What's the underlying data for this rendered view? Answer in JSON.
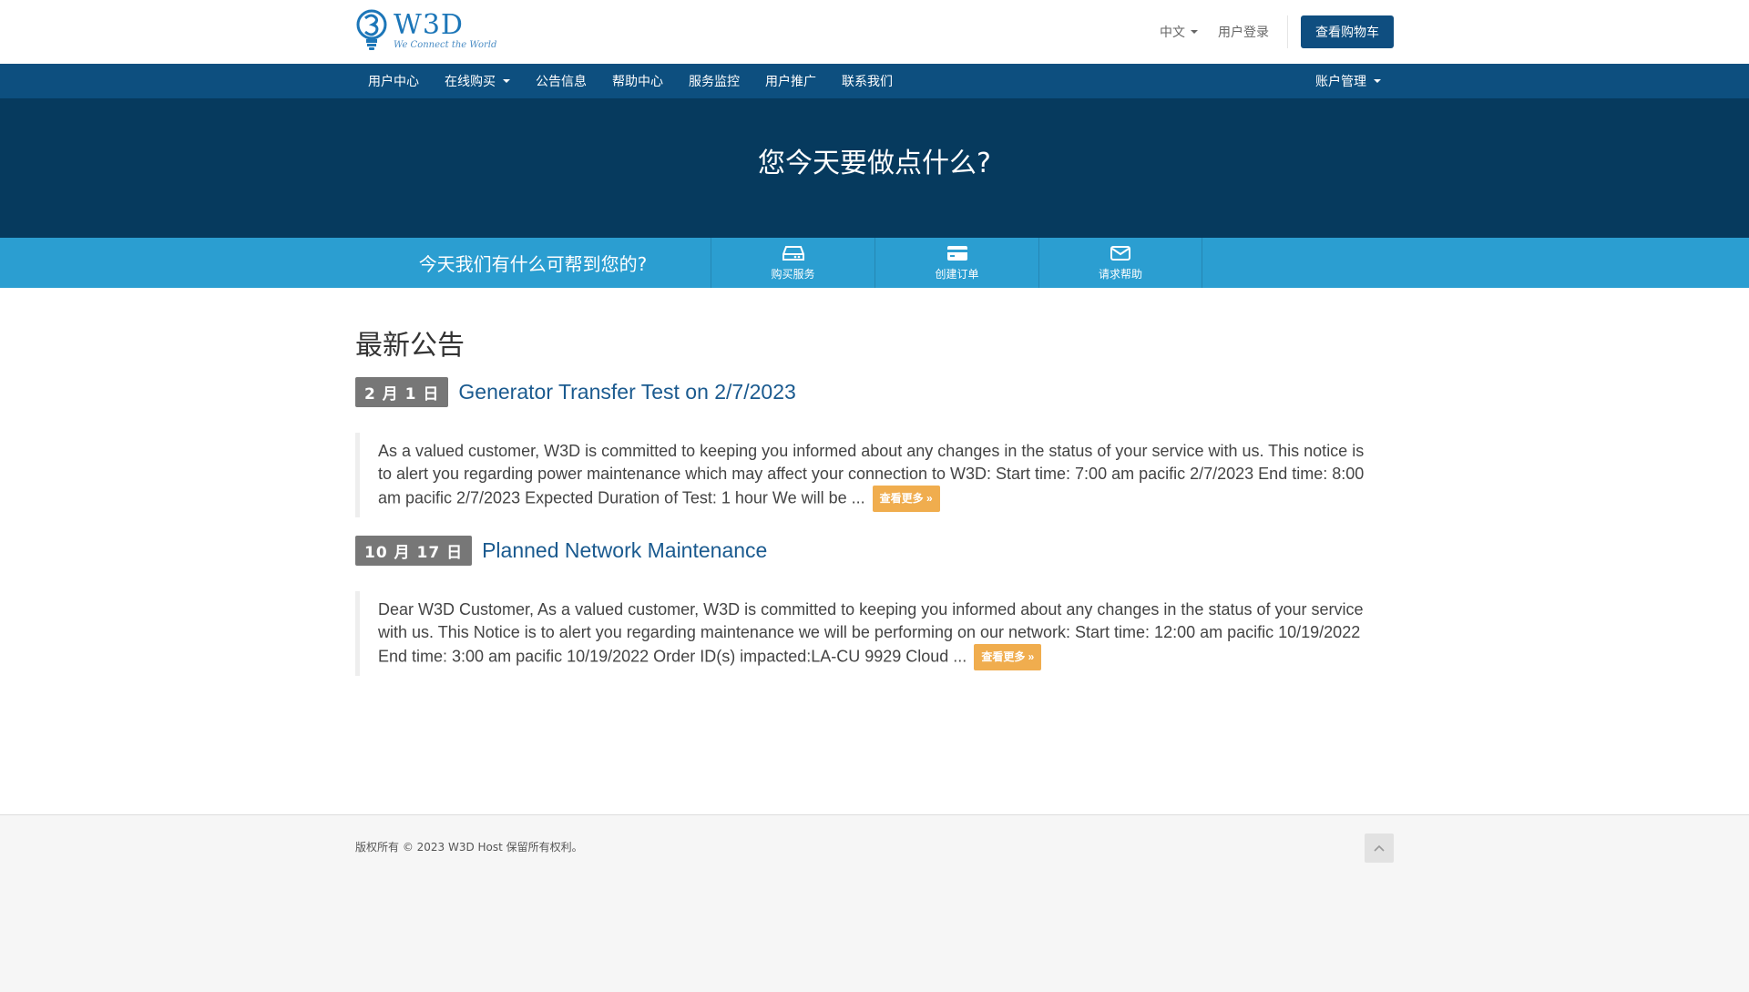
{
  "brand": {
    "name": "W3D",
    "tagline": "We Connect the World",
    "color": "#1c76b8"
  },
  "header": {
    "language": "中文",
    "login": "用户登录",
    "cart": "查看购物车"
  },
  "nav": {
    "items": [
      {
        "label": "用户中心",
        "dropdown": false
      },
      {
        "label": "在线购买",
        "dropdown": true
      },
      {
        "label": "公告信息",
        "dropdown": false
      },
      {
        "label": "帮助中心",
        "dropdown": false
      },
      {
        "label": "服务监控",
        "dropdown": false
      },
      {
        "label": "用户推广",
        "dropdown": false
      },
      {
        "label": "联系我们",
        "dropdown": false
      }
    ],
    "account": "账户管理"
  },
  "hero": {
    "title": "您今天要做点什么?"
  },
  "quick": {
    "title": "今天我们有什么可帮到您的?",
    "actions": [
      {
        "label": "购买服务",
        "icon": "server-icon"
      },
      {
        "label": "创建订单",
        "icon": "credit-card-icon"
      },
      {
        "label": "请求帮助",
        "icon": "envelope-icon"
      }
    ]
  },
  "announcements": {
    "heading": "最新公告",
    "items": [
      {
        "date": "2 月 1 日",
        "title": "Generator Transfer Test on 2/7/2023",
        "excerpt": "As a valued customer, W3D is committed to keeping you informed about any changes in the status of your service with us.  This notice is to alert you regarding power maintenance which may affect your connection to W3D: Start time: 7:00 am pacific 2/7/2023 End time: 8:00 am pacific 2/7/2023 Expected Duration of Test: 1 hour We will be ...",
        "more": "查看更多 »"
      },
      {
        "date": "10 月 17 日",
        "title": "Planned Network Maintenance",
        "excerpt": "Dear W3D Customer, As a valued customer, W3D is committed to keeping you informed about any changes in the status of your service with us. This Notice is to alert you regarding maintenance we will be performing on our network:   Start time: 12:00 am pacific 10/19/2022 End time: 3:00 am pacific 10/19/2022 Order ID(s) impacted:LA-CU 9929 Cloud ...",
        "more": "查看更多 »"
      }
    ]
  },
  "footer": {
    "copyright": "版权所有 © 2023 W3D Host 保留所有权利。",
    "back_to_top_icon": "chevron-up-icon"
  },
  "colors": {
    "navbar": "#0d4f7f",
    "hero": "#063a5e",
    "quick_bar": "#2b9ed1",
    "cart_button": "#0f4e80",
    "more_button": "#f0ad4e",
    "date_label": "#777777"
  }
}
